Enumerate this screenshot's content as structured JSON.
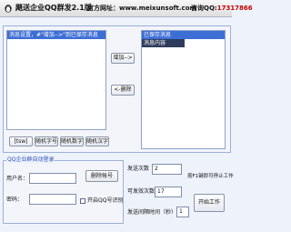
{
  "window": {
    "title": "飓送企业QQ群发2.1版",
    "site_prefix": "官方网址：",
    "site": "www.meixunsoft.com",
    "qq_prefix": "咨询QQ:",
    "qq_number": "17317866"
  },
  "message_panel": {
    "list_header": "消息设置，#\"增加-->\"到已保存消息",
    "add_button": "增加-->",
    "remove_button": "<-删除",
    "saved_header": "已保存消息",
    "saved_column": "消息内容",
    "insert_buttons": [
      "[tsw]",
      "随机字号",
      "随机数字",
      "随机汉字"
    ]
  },
  "login_group": {
    "title": "QQ企业群自动登录",
    "username_label": "用户名：",
    "username_value": "",
    "password_label": "密码：",
    "password_value": "",
    "delete_account_button": "删除帐号",
    "enable_auto_login_label": "开启QQ号识别"
  },
  "send_settings": {
    "send_count_label": "发送次数",
    "send_count_value": "2",
    "sendable_count_label": "可发效次数",
    "sendable_count_value": "17",
    "interval_label": "发送间隔时间（秒）",
    "interval_value": "1",
    "hint_text": "按F1键即可停止工作",
    "start_button": "开始工作"
  },
  "colors": {
    "header_blue": "#3c6ed6",
    "header_dark": "#2f3c5b",
    "group_title": "#2c52b8",
    "qq_red": "#c00000"
  },
  "icons": {
    "app": "penguin-icon"
  }
}
